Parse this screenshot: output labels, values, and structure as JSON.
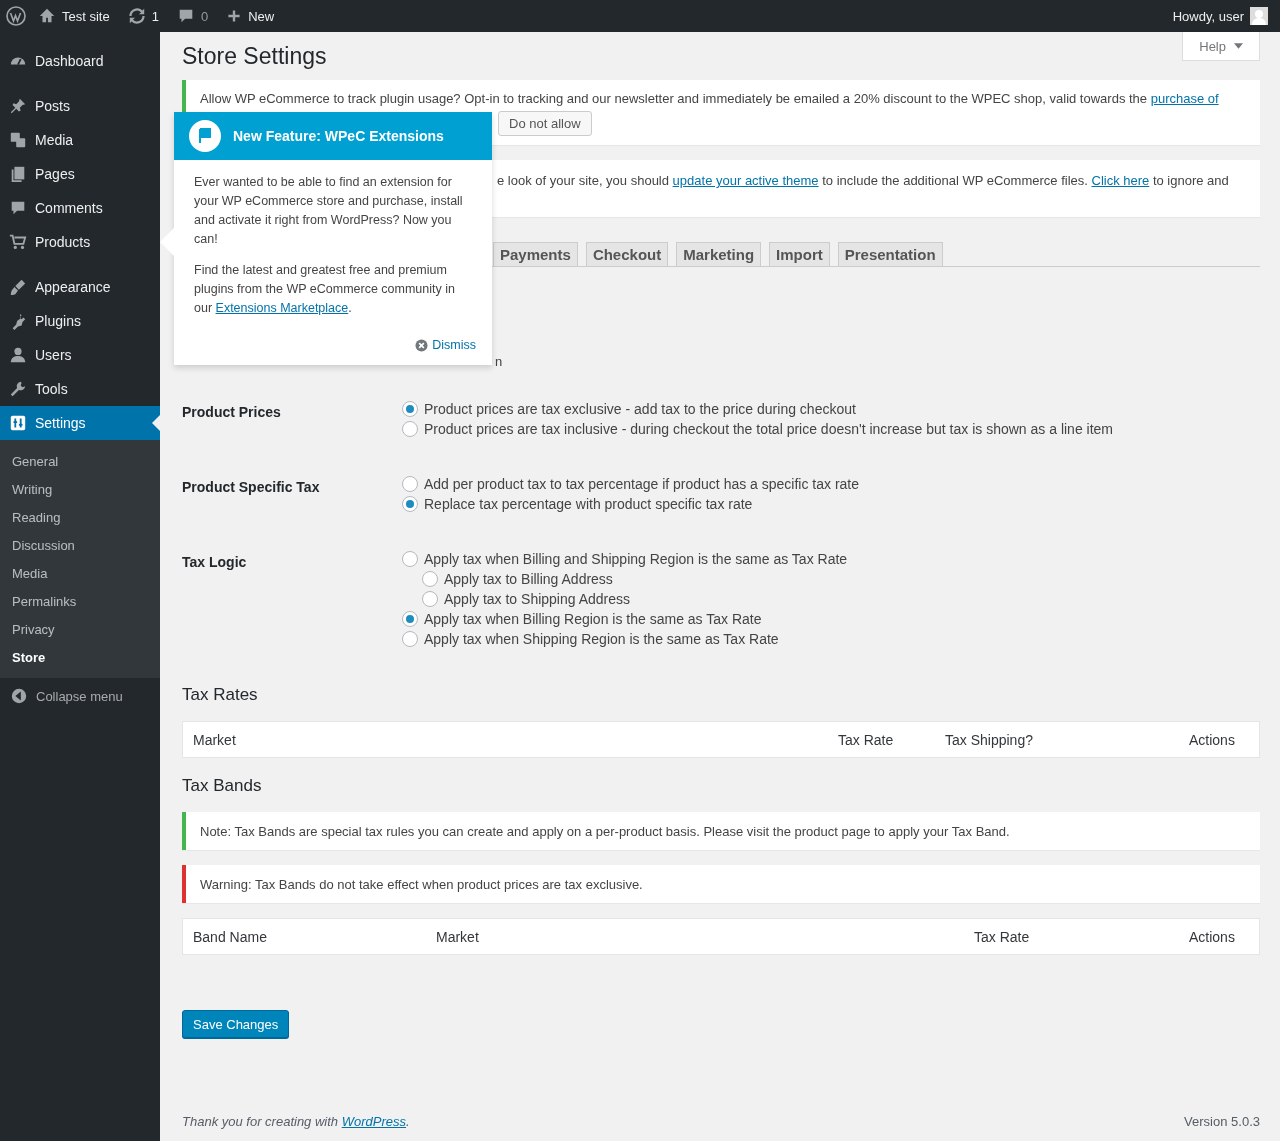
{
  "admin_bar": {
    "site": "Test site",
    "updates": "1",
    "comments": "0",
    "new": "New",
    "greeting": "Howdy, user"
  },
  "sidebar": {
    "groups": [
      [
        {
          "label": "Dashboard",
          "selected": false
        }
      ],
      [
        {
          "label": "Posts",
          "selected": false
        },
        {
          "label": "Media",
          "selected": false
        },
        {
          "label": "Pages",
          "selected": false
        },
        {
          "label": "Comments",
          "selected": false
        },
        {
          "label": "Products",
          "selected": false
        }
      ],
      [
        {
          "label": "Appearance",
          "selected": false
        },
        {
          "label": "Plugins",
          "selected": false
        },
        {
          "label": "Users",
          "selected": false
        },
        {
          "label": "Tools",
          "selected": false
        },
        {
          "label": "Settings",
          "selected": true
        }
      ]
    ],
    "submenu": [
      {
        "label": "General",
        "selected": false
      },
      {
        "label": "Writing",
        "selected": false
      },
      {
        "label": "Reading",
        "selected": false
      },
      {
        "label": "Discussion",
        "selected": false
      },
      {
        "label": "Media",
        "selected": false
      },
      {
        "label": "Permalinks",
        "selected": false
      },
      {
        "label": "Privacy",
        "selected": false
      },
      {
        "label": "Store",
        "selected": true
      }
    ],
    "collapse": "Collapse menu"
  },
  "help_tab": "Help",
  "title": "Store Settings",
  "notices": [
    {
      "kind": "success",
      "parts": [
        {
          "kind": "text",
          "text": "Allow WP eCommerce to track plugin usage? Opt-in to tracking and our newsletter and immediately be emailed a 20% discount to the WPEC shop, valid towards the "
        },
        {
          "kind": "link",
          "text": "purchase of"
        }
      ],
      "button": "Do not allow"
    },
    {
      "kind": "none",
      "parts": [
        {
          "kind": "text",
          "text": "e look of your site, you should "
        },
        {
          "kind": "link",
          "text": "update your active theme"
        },
        {
          "kind": "text",
          "text": " to include the additional WP eCommerce files. "
        },
        {
          "kind": "link",
          "text": "Click here"
        },
        {
          "kind": "text",
          "text": " to ignore and"
        }
      ]
    }
  ],
  "tabs": [
    "Payments",
    "Checkout",
    "Marketing",
    "Import",
    "Presentation"
  ],
  "fragment": "n",
  "form": {
    "rows": [
      {
        "label": "Product Prices",
        "options": [
          {
            "label": "Product prices are tax exclusive - add tax to the price during checkout",
            "selected": true
          },
          {
            "label": "Product prices are tax inclusive - during checkout the total price doesn't increase but tax is shown as a line item",
            "selected": false
          }
        ]
      },
      {
        "label": "Product Specific Tax",
        "options": [
          {
            "label": "Add per product tax to tax percentage if product has a specific tax rate",
            "selected": false
          },
          {
            "label": "Replace tax percentage with product specific tax rate",
            "selected": true
          }
        ]
      },
      {
        "label": "Tax Logic",
        "options": [
          {
            "label": "Apply tax when Billing and Shipping Region is the same as Tax Rate",
            "selected": false,
            "children": [
              {
                "label": "Apply tax to Billing Address",
                "selected": false
              },
              {
                "label": "Apply tax to Shipping Address",
                "selected": false
              }
            ]
          },
          {
            "label": "Apply tax when Billing Region is the same as Tax Rate",
            "selected": true
          },
          {
            "label": "Apply tax when Shipping Region is the same as Tax Rate",
            "selected": false
          }
        ]
      }
    ]
  },
  "tax_rates": {
    "heading": "Tax Rates",
    "columns": [
      "Market",
      "Tax Rate",
      "Tax Shipping?",
      "Actions"
    ]
  },
  "tax_bands": {
    "heading": "Tax Bands",
    "notices": [
      {
        "kind": "success",
        "parts": [
          {
            "kind": "text",
            "text": "Note: Tax Bands are special tax rules you can create and apply on a per-product basis. Please visit the product page to apply your Tax Band."
          }
        ]
      },
      {
        "kind": "error",
        "parts": [
          {
            "kind": "text",
            "text": "Warning: Tax Bands do not take effect when product prices are tax exclusive."
          }
        ]
      }
    ],
    "columns": [
      "Band Name",
      "Market",
      "Tax Rate",
      "Actions"
    ]
  },
  "save_button": "Save Changes",
  "footer": {
    "text": "Thank you for creating with ",
    "link": "WordPress",
    "after": ".",
    "version": "Version 5.0.3"
  },
  "popup": {
    "title": "New Feature: WPeC Extensions",
    "paragraphs": [
      [
        {
          "kind": "text",
          "text": "Ever wanted to be able to find an extension for your WP eCommerce store and purchase, install and activate it right from WordPress? Now you can!"
        }
      ],
      [
        {
          "kind": "text",
          "text": "Find the latest and greatest free and premium plugins from the WP eCommerce community in our "
        },
        {
          "kind": "link",
          "text": "Extensions Marketplace"
        },
        {
          "kind": "text",
          "text": "."
        }
      ]
    ],
    "dismiss": "Dismiss"
  }
}
